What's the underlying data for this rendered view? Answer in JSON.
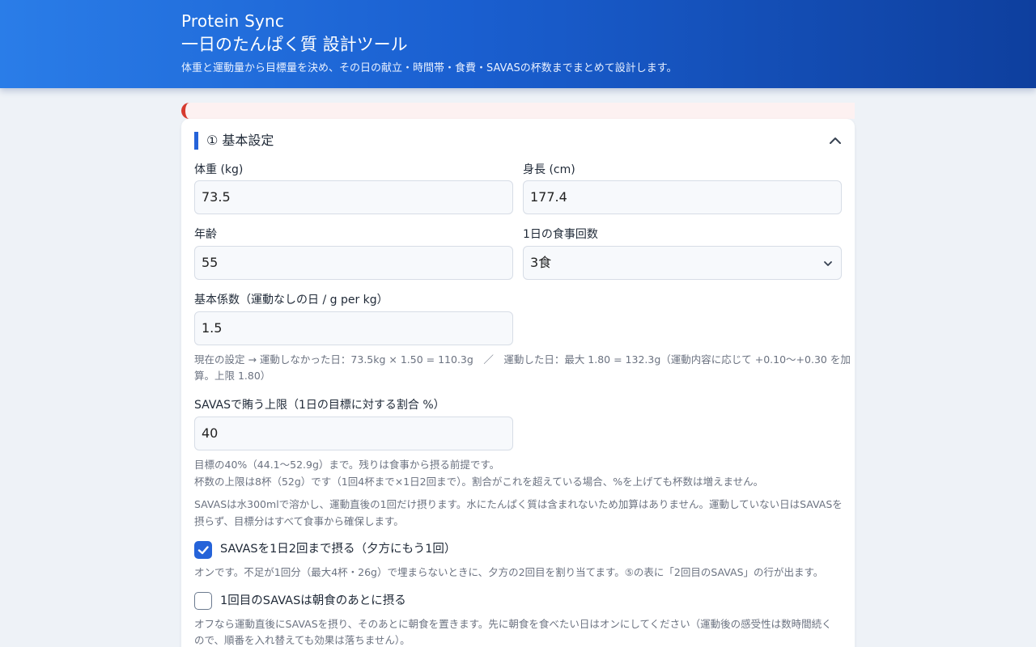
{
  "header": {
    "app_name": "Protein Sync",
    "title": "一日のたんぱく質 設計ツール",
    "description": "体重と運動量から目標量を決め、その日の献立・時間帯・食費・SAVASの杯数までまとめて設計します。"
  },
  "section": {
    "title": "① 基本設定",
    "toggle_icon": "chevron-up-icon"
  },
  "fields": {
    "weight": {
      "label": "体重 (kg)",
      "value": "73.5"
    },
    "height": {
      "label": "身長 (cm)",
      "value": "177.4"
    },
    "age": {
      "label": "年齢",
      "value": "55"
    },
    "meals": {
      "label": "1日の食事回数",
      "value": "3食"
    },
    "coef": {
      "label": "基本係数（運動なしの日 / g per kg）",
      "value": "1.5"
    },
    "savas_limit": {
      "label": "SAVASで賄う上限（1日の目標に対する割合 %）",
      "value": "40"
    }
  },
  "notes": {
    "current_line1": "現在の設定 → 運動しなかった日：73.5kg × 1.50 = 110.3g　／　運動した日：最大 1.80 = 132.3g（運動内容に応じて +0.10〜+0.30 を加",
    "current_line2": "算。上限 1.80）",
    "limit_line1": "目標の40%（44.1〜52.9g）まで。残りは食事から摂る前提です。",
    "limit_line2": "杯数の上限は8杯（52g）です（1回4杯まで×1日2回まで）。割合がこれを超えている場合、%を上げても杯数は増えません。",
    "water_line1": "SAVASは水300mlで溶かし、運動直後の1回だけ摂ります。水にたんぱく質は含まれないため加算はありません。運動していない日はSAVASを",
    "water_line2": "摂らず、目標分はすべて食事から確保します。"
  },
  "checkboxes": {
    "twice": {
      "label": "SAVASを1日2回まで摂る（夕方にもう1回）",
      "checked": true,
      "note": "オンです。不足が1回分（最大4杯・26g）で埋まらないときに、夕方の2回目を割り当てます。⑤の表に「2回目のSAVAS」の行が出ます。"
    },
    "after_breakfast": {
      "label": "1回目のSAVASは朝食のあとに摂る",
      "checked": false,
      "note_line1": "オフなら運動直後にSAVASを摂り、そのあとに朝食を置きます。先に朝食を食べたい日はオンにしてください（運動後の感受性は数時間続く",
      "note_line2": "ので、順番を入れ替えても効果は落ちません）。"
    }
  },
  "colors": {
    "header_start": "#2a7de8",
    "header_end": "#0e3f9e",
    "accent": "#2563d9",
    "alert": "#d63a2f"
  }
}
